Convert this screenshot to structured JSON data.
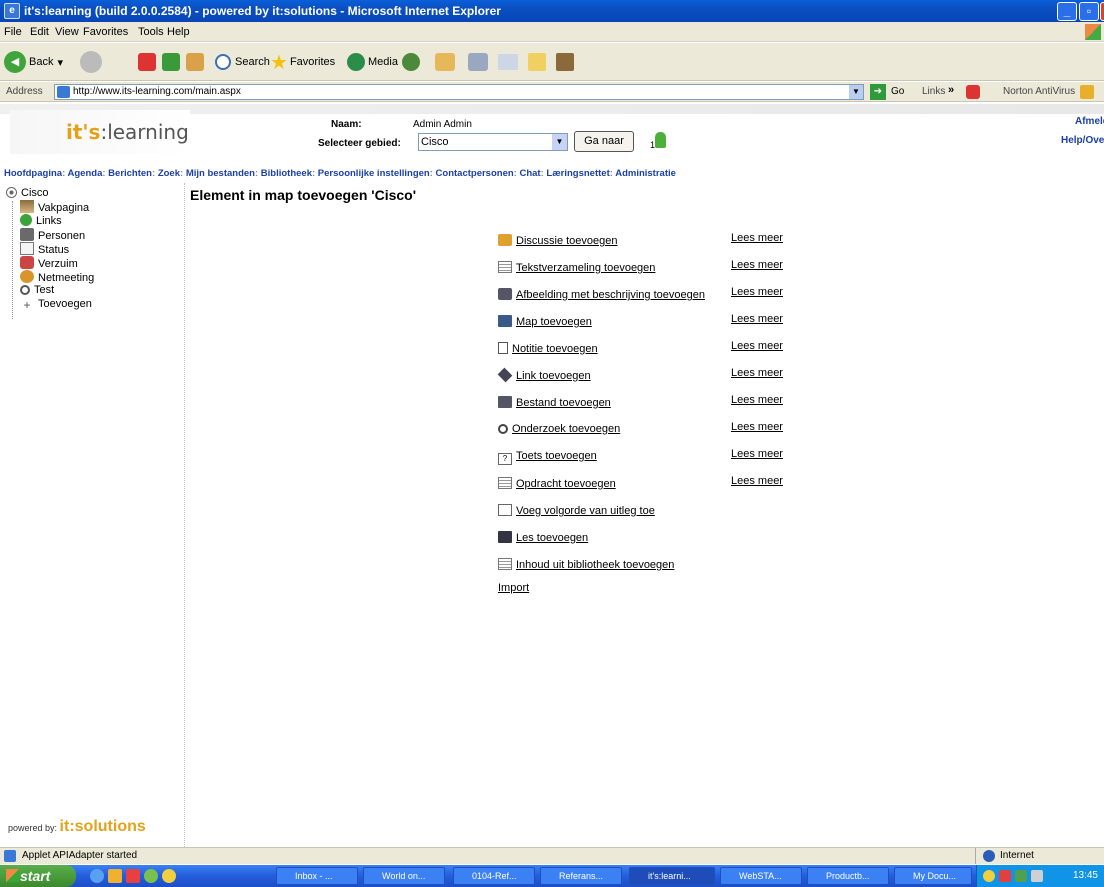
{
  "window": {
    "title": "it's:learning (build 2.0.0.2584) - powered by it:solutions - Microsoft Internet Explorer"
  },
  "menu": [
    "File",
    "Edit",
    "View",
    "Favorites",
    "Tools",
    "Help"
  ],
  "toolbar": {
    "back": "Back",
    "search": "Search",
    "favorites": "Favorites",
    "media": "Media"
  },
  "address": {
    "label": "Address",
    "url": "http://www.its-learning.com/main.aspx",
    "go": "Go",
    "links": "Links",
    "norton": "Norton AntiVirus"
  },
  "page": {
    "logo_its": "it's",
    "logo_learning": ":learning",
    "naam_label": "Naam:",
    "naam_value": "Admin Admin",
    "gebied_label": "Selecteer gebied:",
    "gebied_value": "Cisco",
    "ganaar": "Ga naar",
    "online_count": "1",
    "afmelden": "Afmelde",
    "help": "Help/Ove"
  },
  "nav": [
    "Hoofdpagina",
    "Agenda",
    "Berichten",
    "Zoek",
    "Mijn bestanden",
    "Bibliotheek",
    "Persoonlijke instellingen",
    "Contactpersonen",
    "Chat",
    "Læringsnettet",
    "Administratie"
  ],
  "tree": {
    "root": "Cisco",
    "items": [
      "Vakpagina",
      "Links",
      "Personen",
      "Status",
      "Verzuim",
      "Netmeeting",
      "Test",
      "Toevoegen"
    ]
  },
  "main": {
    "heading": "Element in map toevoegen 'Cisco'",
    "items": [
      {
        "label": "Discussie toevoegen",
        "more": "Lees meer"
      },
      {
        "label": "Tekstverzameling toevoegen",
        "more": "Lees meer"
      },
      {
        "label": "Afbeelding met beschrijving toevoegen",
        "more": "Lees meer"
      },
      {
        "label": "Map toevoegen",
        "more": "Lees meer"
      },
      {
        "label": "Notitie toevoegen",
        "more": "Lees meer"
      },
      {
        "label": "Link toevoegen",
        "more": "Lees meer"
      },
      {
        "label": "Bestand toevoegen",
        "more": "Lees meer"
      },
      {
        "label": "Onderzoek toevoegen",
        "more": "Lees meer"
      },
      {
        "label": "Toets toevoegen",
        "more": "Lees meer"
      },
      {
        "label": "Opdracht toevoegen",
        "more": "Lees meer"
      },
      {
        "label": "Voeg volgorde van uitleg toe"
      },
      {
        "label": "Les toevoegen"
      },
      {
        "label": "Inhoud uit bibliotheek toevoegen"
      },
      {
        "label": "Import"
      }
    ]
  },
  "footer": {
    "powered": "powered by:",
    "brand": "it:solutions"
  },
  "status": {
    "text": "Applet APIAdapter started",
    "zone": "Internet"
  },
  "taskbar": {
    "start": "start",
    "tasks": [
      "Inbox - ...",
      "World on...",
      "0104-Ref...",
      "Referans...",
      "it's:learni...",
      "WebSTA...",
      "Productb...",
      "My Docu..."
    ],
    "clock": "13:45"
  }
}
